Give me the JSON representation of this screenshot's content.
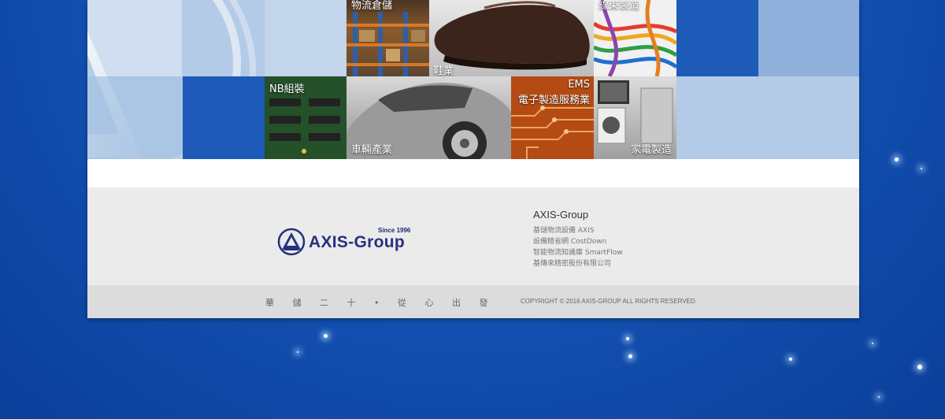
{
  "industries": [
    {
      "id": "logistics",
      "label": "物流倉儲"
    },
    {
      "id": "shoes",
      "label": "鞋業"
    },
    {
      "id": "wire",
      "label": "線束製造"
    },
    {
      "id": "nb",
      "label": "NB組裝"
    },
    {
      "id": "car",
      "label": "車輛產業"
    },
    {
      "id": "ems_en",
      "label": "EMS"
    },
    {
      "id": "ems",
      "label": "電子製造服務業"
    },
    {
      "id": "appliance",
      "label": "家電製造"
    }
  ],
  "logo": {
    "since": "Since 1996",
    "name": "AXIS-Group",
    "mark": "AXIS"
  },
  "footer": {
    "links_title": "AXIS-Group",
    "links": [
      "基儲物流設備 AXIS",
      "設備精省網 CostDown",
      "智能物流知識庫 SmartFlow",
      "基傳來精密股份有限公司"
    ],
    "slogan": "華 儲 二 十 • 從 心 出 發",
    "copyright": "COPYRIGHT © 2016 AXIS-GROUP ALL RIGHTS RESERVED."
  },
  "colors": {
    "brand": "#26307e",
    "tile_blue": "#1e5bb8",
    "tile_light": "#b3cbe6"
  }
}
